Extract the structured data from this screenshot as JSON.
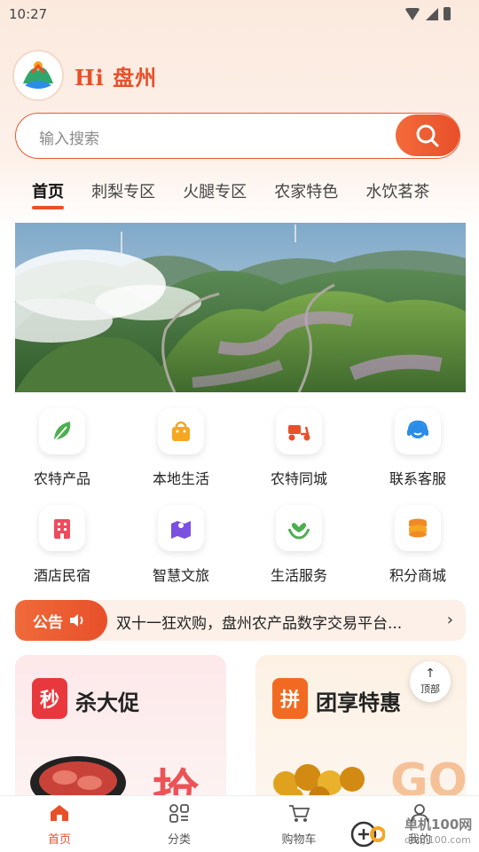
{
  "status_bar": {
    "time": "10:27"
  },
  "header": {
    "greeting": "Hi  盘州"
  },
  "search": {
    "placeholder": "输入搜索"
  },
  "tabs": [
    "首页",
    "刺梨专区",
    "火腿专区",
    "农家特色",
    "水饮茗茶"
  ],
  "quick_menu": [
    {
      "label": "农特产品",
      "icon": "leaf-icon",
      "color": "#4caf50"
    },
    {
      "label": "本地生活",
      "icon": "shopping-bag-icon",
      "color": "#f5a623"
    },
    {
      "label": "农特同城",
      "icon": "delivery-scooter-icon",
      "color": "#e8502a"
    },
    {
      "label": "联系客服",
      "icon": "headset-icon",
      "color": "#2a8de8"
    },
    {
      "label": "酒店民宿",
      "icon": "hotel-icon",
      "color": "#ef4b5c"
    },
    {
      "label": "智慧文旅",
      "icon": "map-pin-icon",
      "color": "#7b4fe0"
    },
    {
      "label": "生活服务",
      "icon": "heart-hands-icon",
      "color": "#4caf50"
    },
    {
      "label": "积分商城",
      "icon": "coins-icon",
      "color": "#f08a24"
    }
  ],
  "notice": {
    "tag": "公告",
    "text": "双十一狂欢购，盘州农产品数字交易平台...",
    "arrow": "›"
  },
  "promo_cards": [
    {
      "badge": "秒",
      "title": "杀大促",
      "big_text": "抢",
      "accent": "#e8383d"
    },
    {
      "badge": "拼",
      "title": "团享特惠",
      "big_text": "GO",
      "accent": "#f26a22"
    }
  ],
  "back_to_top": {
    "arrow": "↑",
    "label": "顶部"
  },
  "bottom_nav": [
    {
      "label": "首页",
      "icon": "home-icon"
    },
    {
      "label": "分类",
      "icon": "category-icon"
    },
    {
      "label": "购物车",
      "icon": "cart-icon"
    },
    {
      "label": "我的",
      "icon": "user-icon"
    }
  ],
  "watermark": {
    "text": "单机100网",
    "subtext": "danji100.com"
  },
  "colors": {
    "accent": "#e8502a",
    "notice_bg": "#fdf0e8"
  }
}
